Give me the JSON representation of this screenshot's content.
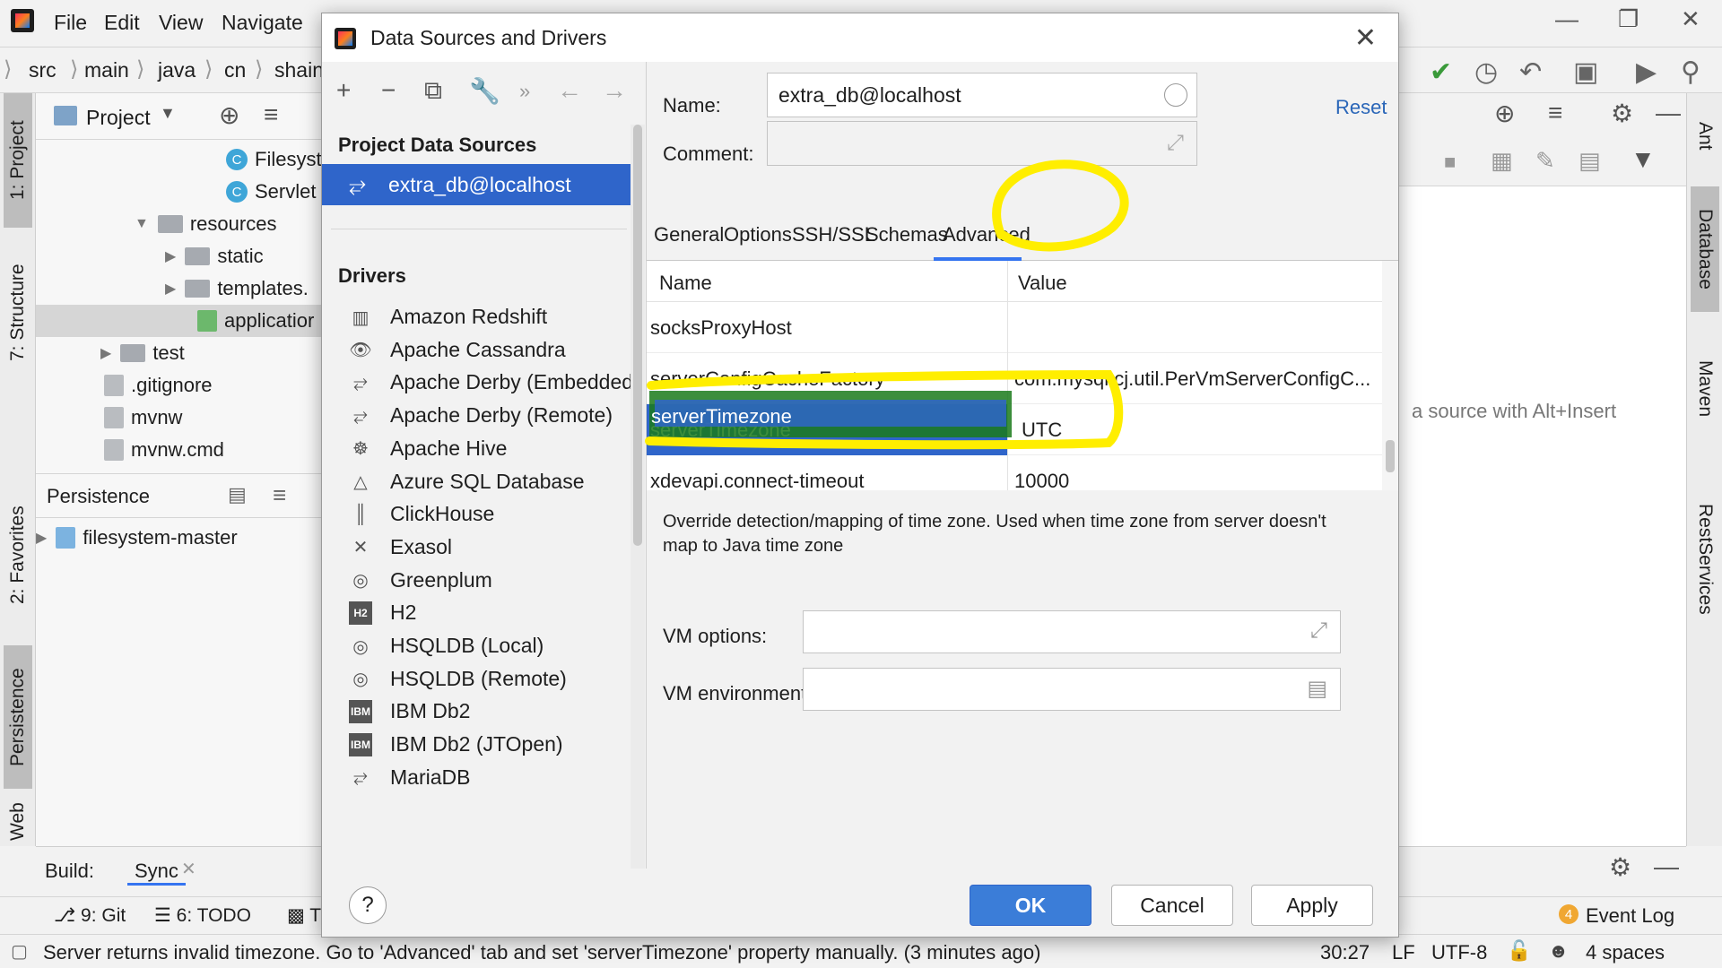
{
  "menubar": {
    "items": [
      "File",
      "Edit",
      "View",
      "Navigate"
    ]
  },
  "breadcrumb": [
    "src",
    "main",
    "java",
    "cn",
    "shain"
  ],
  "left_strip": {
    "tabs": [
      "1: Project",
      "7: Structure",
      "2: Favorites",
      "Persistence",
      "Web"
    ]
  },
  "right_strip": {
    "tabs": [
      "Ant",
      "Database",
      "Maven",
      "RestServices"
    ]
  },
  "project_panel": {
    "title": "Project",
    "tree": [
      {
        "label": "Filesyst",
        "kind": "class"
      },
      {
        "label": "Servlet",
        "kind": "class"
      },
      {
        "label": "resources",
        "kind": "folder"
      },
      {
        "label": "static",
        "kind": "folder"
      },
      {
        "label": "templates.",
        "kind": "folder"
      },
      {
        "label": "applicatior",
        "kind": "file"
      },
      {
        "label": "test",
        "kind": "folder"
      },
      {
        "label": ".gitignore",
        "kind": "file"
      },
      {
        "label": "mvnw",
        "kind": "file"
      },
      {
        "label": "mvnw.cmd",
        "kind": "file"
      }
    ]
  },
  "persistence_panel": {
    "title": "Persistence",
    "item": "filesystem-master"
  },
  "editor_hint": "a source with Alt+Insert",
  "build_bar": {
    "label": "Build:",
    "tab": "Sync"
  },
  "bottom_tools": {
    "git": "9: Git",
    "todo": "6: TODO",
    "terminal": "T",
    "event_log": "Event Log",
    "event_count": "4"
  },
  "statusbar": {
    "message": "Server returns invalid timezone. Go to 'Advanced' tab and set 'serverTimezone' property manually. (3 minutes ago)",
    "position": "30:27",
    "line_sep": "LF",
    "encoding": "UTF-8",
    "indent": "4 spaces"
  },
  "dialog": {
    "title": "Data Sources and Drivers",
    "project_sources_header": "Project Data Sources",
    "selected_source": "extra_db@localhost",
    "drivers_header": "Drivers",
    "drivers": [
      "Amazon Redshift",
      "Apache Cassandra",
      "Apache Derby (Embedded)",
      "Apache Derby (Remote)",
      "Apache Hive",
      "Azure SQL Database",
      "ClickHouse",
      "Exasol",
      "Greenplum",
      "H2",
      "HSQLDB (Local)",
      "HSQLDB (Remote)",
      "IBM Db2",
      "IBM Db2 (JTOpen)",
      "MariaDB"
    ],
    "name_label": "Name:",
    "name_value": "extra_db@localhost",
    "comment_label": "Comment:",
    "comment_value": "",
    "reset_label": "Reset",
    "tabs": [
      "General",
      "Options",
      "SSH/SSL",
      "Schemas",
      "Advanced"
    ],
    "active_tab": "Advanced",
    "props_columns": [
      "Name",
      "Value"
    ],
    "properties": [
      {
        "name": "socksProxyHost",
        "value": ""
      },
      {
        "name": "serverConfigCacheFactory",
        "value": "com.mysql.cj.util.PerVmServerConfigC..."
      },
      {
        "name": "serverTimezone",
        "value": "UTC"
      },
      {
        "name": "xdevapi.connect-timeout",
        "value": "10000"
      }
    ],
    "description": "Override detection/mapping of time zone. Used when time zone from server doesn't map to Java time zone",
    "vm_options_label": "VM options:",
    "vm_options_value": "",
    "vm_env_label": "VM environment:",
    "vm_env_value": "",
    "help_label": "?",
    "ok_label": "OK",
    "cancel_label": "Cancel",
    "apply_label": "Apply"
  },
  "colors": {
    "selection": "#2f65ca",
    "primary_button": "#3b7dd8",
    "link": "#2a66b8",
    "annotation_marker": "#ffee00",
    "annotation_green": "#1a7a1a"
  }
}
